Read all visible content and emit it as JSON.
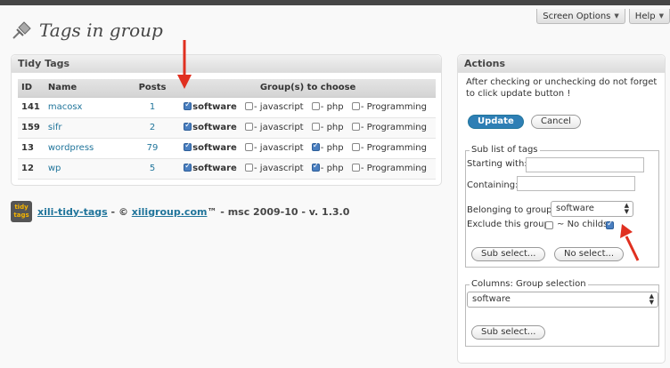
{
  "header": {
    "screen_options": "Screen Options",
    "help": "Help",
    "page_title": "Tags in group"
  },
  "tidy": {
    "title": "Tidy Tags",
    "columns": {
      "id": "ID",
      "name": "Name",
      "posts": "Posts",
      "groups": "Group(s) to choose"
    },
    "group_labels": [
      "software",
      "- javascript",
      "- php",
      "- Programming"
    ],
    "rows": [
      {
        "id": "141",
        "name": "macosx",
        "posts": "1"
      },
      {
        "id": "159",
        "name": "sifr",
        "posts": "2"
      },
      {
        "id": "13",
        "name": "wordpress",
        "posts": "79"
      },
      {
        "id": "12",
        "name": "wp",
        "posts": "5"
      }
    ]
  },
  "footer": {
    "logo_text": "tidy tags",
    "product": "xili-tidy-tags",
    "sep": " - © ",
    "site": "xiligroup.com",
    "tail": "™ - msc 2009-10 - v. 1.3.0"
  },
  "actions": {
    "title": "Actions",
    "note": "After checking or unchecking do not forget to click update button !",
    "update_label": "Update",
    "cancel_label": "Cancel",
    "sublist_legend": "Sub list of tags",
    "starting_with_label": "Starting with:",
    "containing_label": "Containing:",
    "belonging_label": "Belonging to group:",
    "belonging_value": "software",
    "exclude_label": "Exclude this group",
    "no_childs_label": "No childs",
    "subselect_label": "Sub select...",
    "noselect_label": "No select...",
    "columns_legend": "Columns: Group selection",
    "columns_value": "software",
    "subselect2_label": "Sub select..."
  }
}
